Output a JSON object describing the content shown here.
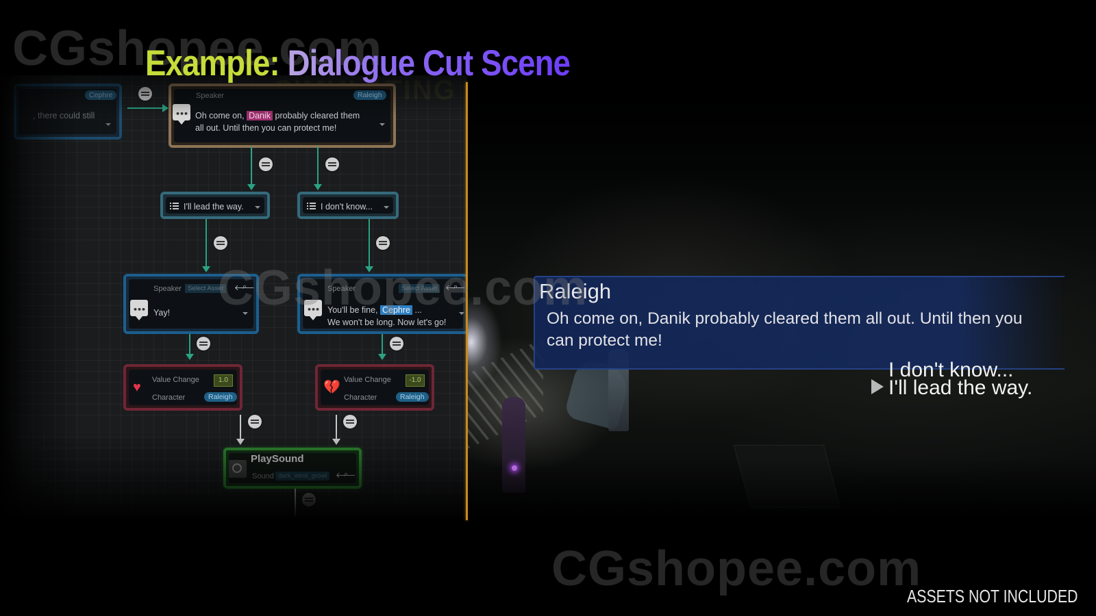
{
  "title": {
    "prefix": "Example:",
    "main": "Dialogue Cut Scene"
  },
  "watermark": "CGshopee.com",
  "graph_background_text": "SIMULATING",
  "footer_note": "ASSETS NOT INCLUDED",
  "colors": {
    "title_prefix": "#c6dc3a",
    "title_main": "#6d3dfa",
    "divider": "#c98a1c",
    "dialogue_bg": "#16305e"
  },
  "graph": {
    "node_prev": {
      "speaker_pill": "Cephre",
      "text": ", there could still"
    },
    "node_speaker_main": {
      "label": "Speaker",
      "speaker_pill": "Raleigh",
      "text_before": "Oh come on,",
      "highlight": "Danik",
      "text_after": "probably cleared them",
      "line2": "all out. Until then you can protect me!"
    },
    "choice_nodes": [
      {
        "label": "I'll lead the way."
      },
      {
        "label": "I don't know..."
      }
    ],
    "node_reply_left": {
      "label": "Speaker",
      "asset_select": "Select Asset",
      "text": "Yay!"
    },
    "node_reply_right": {
      "label": "Speaker",
      "asset_select": "Select Asset",
      "text_before": "You'll be fine,",
      "highlight": "Cephre",
      "text_after": "...",
      "line2": "We won't be long. Now let's go!"
    },
    "value_nodes": [
      {
        "label": "Value Change",
        "value": "1.0",
        "character_label": "Character",
        "character": "Raleigh",
        "icon": "heart-icon"
      },
      {
        "label": "Value Change",
        "value": "-1.0",
        "character_label": "Character",
        "character": "Raleigh",
        "icon": "broken-heart-icon"
      }
    ],
    "play_sound": {
      "title": "PlaySound",
      "sound_label": "Sound",
      "sound_value": "dark_wind_growl"
    }
  },
  "scene": {
    "speaker": "Raleigh",
    "line": "Oh come on, Danik probably cleared them all out. Until then you can protect me!",
    "choices": [
      {
        "text": "I don't know...",
        "selected": false
      },
      {
        "text": "I'll lead the way.",
        "selected": true
      }
    ]
  }
}
